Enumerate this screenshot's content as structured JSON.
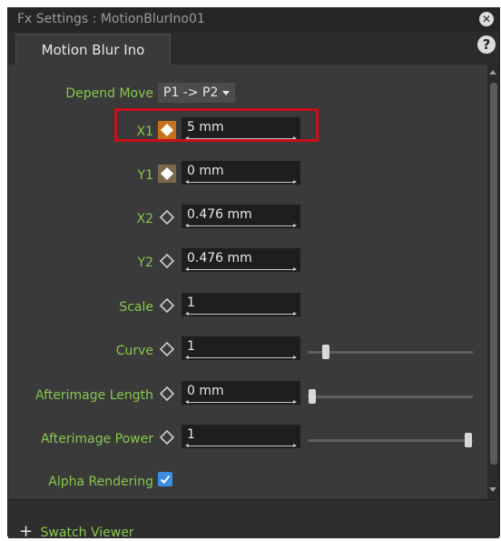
{
  "window": {
    "title": "Fx Settings : MotionBlurIno01"
  },
  "tab": {
    "label": "Motion Blur Ino"
  },
  "depend_move": {
    "label": "Depend Move",
    "value": "P1 -> P2"
  },
  "params": [
    {
      "label": "X1",
      "value": "5 mm",
      "keyframe": "active"
    },
    {
      "label": "Y1",
      "value": "0 mm",
      "keyframe": "set"
    },
    {
      "label": "X2",
      "value": "0.476 mm",
      "keyframe": "none"
    },
    {
      "label": "Y2",
      "value": "0.476 mm",
      "keyframe": "none"
    },
    {
      "label": "Scale",
      "value": "1",
      "keyframe": "none"
    },
    {
      "label": "Curve",
      "value": "1",
      "keyframe": "none",
      "slider": 0.1
    },
    {
      "label": "Afterimage Length",
      "value": "0 mm",
      "keyframe": "none",
      "slider": 0.0
    },
    {
      "label": "Afterimage Power",
      "value": "1",
      "keyframe": "none",
      "slider": 1.0
    }
  ],
  "alpha_rendering": {
    "label": "Alpha Rendering",
    "checked": true
  },
  "footer": {
    "swatch_label": "Swatch Viewer"
  },
  "colors": {
    "label_green": "#85c84e",
    "keyframe_orange": "#c8701a",
    "highlight_red": "#c8101a",
    "checkbox_blue": "#3a8ee6"
  }
}
